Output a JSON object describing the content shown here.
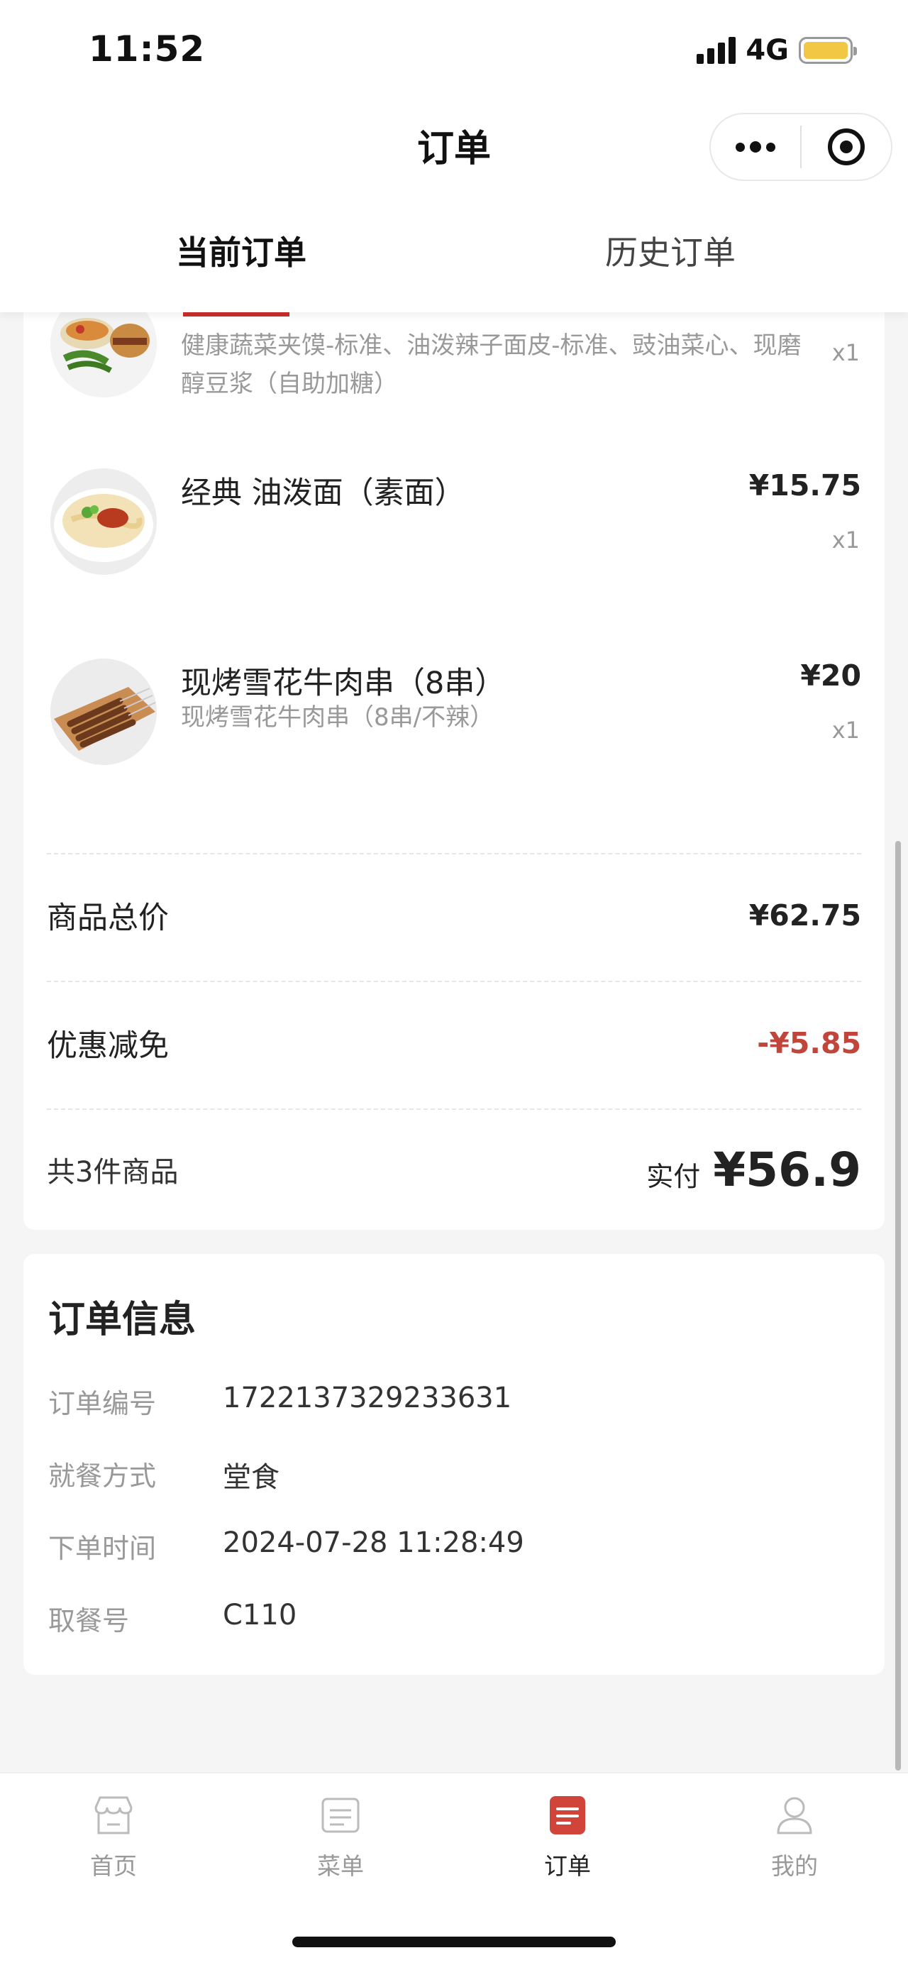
{
  "status_bar": {
    "time": "11:52",
    "network": "4G"
  },
  "header": {
    "title": "订单"
  },
  "tabs": {
    "current": "当前订单",
    "history": "历史订单"
  },
  "order": {
    "items": [
      {
        "name": "",
        "desc": "健康蔬菜夹馍-标准、油泼辣子面皮-标准、豉油菜心、现磨醇豆浆（自助加糖）",
        "price": "",
        "qty": "x1"
      },
      {
        "name": "经典 油泼面（素面）",
        "desc": "",
        "price": "¥15.75",
        "qty": "x1"
      },
      {
        "name": "现烤雪花牛肉串（8串）",
        "desc": "现烤雪花牛肉串（8串/不辣）",
        "price": "¥20",
        "qty": "x1"
      }
    ],
    "subtotal_label": "商品总价",
    "subtotal_value": "¥62.75",
    "discount_label": "优惠减免",
    "discount_value": "-¥5.85",
    "count_label": "共3件商品",
    "paid_label": "实付",
    "paid_value": "¥56.9"
  },
  "order_info": {
    "title": "订单信息",
    "rows": [
      {
        "key": "订单编号",
        "value": "1722137329233631"
      },
      {
        "key": "就餐方式",
        "value": "堂食"
      },
      {
        "key": "下单时间",
        "value": "2024-07-28 11:28:49"
      },
      {
        "key": "取餐号",
        "value": "C110"
      }
    ]
  },
  "tabbar": {
    "items": [
      {
        "label": "首页",
        "icon": "store-icon"
      },
      {
        "label": "菜单",
        "icon": "menu-list-icon"
      },
      {
        "label": "订单",
        "icon": "order-icon"
      },
      {
        "label": "我的",
        "icon": "profile-icon"
      }
    ],
    "active": "订单"
  },
  "colors": {
    "accent_red": "#c0463c",
    "battery_yellow": "#f2c744"
  }
}
